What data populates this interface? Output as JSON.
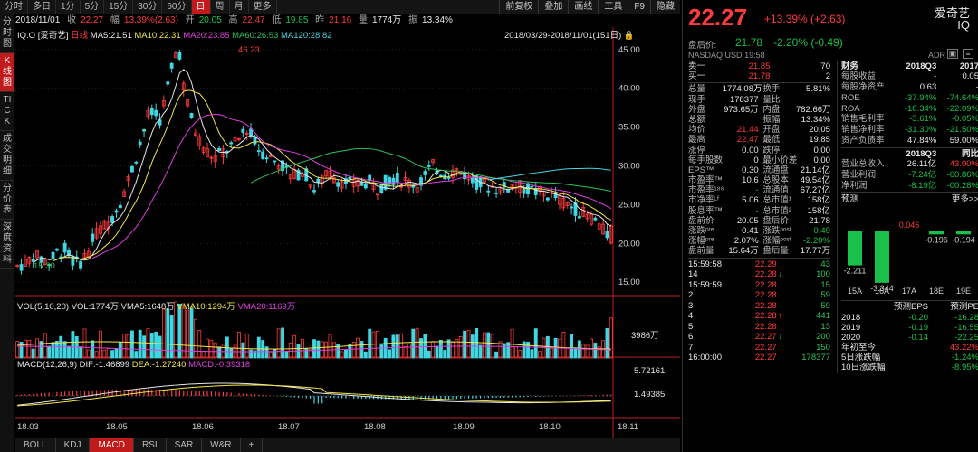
{
  "toolbar": {
    "periods": [
      "分时",
      "多日",
      "1分",
      "5分",
      "15分",
      "30分",
      "60分",
      "日",
      "周",
      "月",
      "更多"
    ],
    "active_period": "日",
    "tools": [
      "前复权",
      "叠加",
      "画线",
      "工具",
      "F9",
      "隐藏"
    ]
  },
  "infoline": {
    "date": "2018/11/01",
    "close_label": "收",
    "close": "22.27",
    "chg_label": "幅",
    "chg": "13.39%(2.63)",
    "open_label": "开",
    "open": "20.05",
    "high_label": "高",
    "high": "22.47",
    "low_label": "低",
    "low": "19.85",
    "prev_label": "昨",
    "prev": "21.16",
    "vol_label": "量",
    "vol": "1774万",
    "amp_label": "振",
    "amp": "13.34%"
  },
  "left_tabs": [
    "分时图",
    "K线图",
    "TICK",
    "成交明细",
    "分价表",
    "深度资料"
  ],
  "active_left_tab": "K线图",
  "main_legend": {
    "symbol": "IQ.O",
    "name": "[爱奇艺]",
    "mode": "日线",
    "ma5": "MA5:21.51",
    "ma10": "MA10:22.31",
    "ma20": "MA20:23.85",
    "ma60": "MA60:26.53",
    "ma120": "MA120:28.82",
    "range": "2018/03/29-2018/11/01(151日)",
    "high_mark": "46.23",
    "low_mark": "15.30"
  },
  "vol_legend": {
    "title": "VOL(5,10,20)",
    "vol": "VOL:1774万",
    "vma5": "VMA5:1648万",
    "vma10": "VMA10:1294万",
    "vma20": "VMA20:1169万",
    "axis_label": "3986万"
  },
  "macd_legend": {
    "title": "MACD(12,26,9)",
    "dif": "DIF:-1.46899",
    "dea": "DEA:-1.27240",
    "macd": "MACD:-0.39318",
    "top": "5.72161",
    "mid": "1.49385"
  },
  "x_labels": [
    "18.03",
    "18.05",
    "18.06",
    "18.07",
    "18.08",
    "18.09",
    "18.10",
    "18.11"
  ],
  "y_labels": [
    "45.00",
    "40.00",
    "35.00",
    "30.00",
    "25.00",
    "20.00",
    "15.00"
  ],
  "bottom_tabs": [
    "BOLL",
    "KDJ",
    "MACD",
    "RSI",
    "SAR",
    "W&R",
    "+"
  ],
  "active_bottom_tab": "MACD",
  "quote": {
    "price": "22.27",
    "change": "+13.39% (+2.63)",
    "name": "爱奇艺",
    "ticker": "IQ",
    "after_label": "盘后价:",
    "after_price": "21.78",
    "after_change": "-2.20% (-0.49)",
    "exchange": "NASDAQ",
    "currency": "USD",
    "time": "19:58",
    "adr": "ADR"
  },
  "orderbook": [
    {
      "label": "卖一",
      "price": "21.85",
      "vol": "70"
    },
    {
      "label": "买一",
      "price": "21.78",
      "vol": "2"
    }
  ],
  "stats": [
    [
      "总量",
      "1774.08万",
      "换手",
      "5.81%"
    ],
    [
      "现手",
      "178377",
      "量比",
      ""
    ],
    [
      "外盘",
      "973.65万",
      "内盘",
      "782.66万"
    ],
    [
      "总额",
      "",
      "振幅",
      "13.34%"
    ],
    [
      "均价",
      "21.44",
      "开盘",
      "20.05"
    ],
    [
      "最高",
      "22.47",
      "最低",
      "19.85"
    ],
    [
      "涨停",
      "0.00",
      "跌停",
      "0.00"
    ],
    [
      "每手股数",
      "0",
      "最小价差",
      "0.00"
    ],
    [
      "EPS™",
      "0.30",
      "流通盘",
      "21.14亿"
    ],
    [
      "市盈率™",
      "10.6",
      "总股本",
      "49.54亿"
    ],
    [
      "市盈率¹⁸⁶",
      "-",
      "流通值",
      "67.27亿"
    ],
    [
      "市净率ᴸᶠ",
      "5.06",
      "总市值¹",
      "158亿"
    ],
    [
      "股息率™",
      "-",
      "总市值²",
      "158亿"
    ],
    [
      "盘前价",
      "20.05",
      "盘后价",
      "21.78"
    ],
    [
      "涨跌ᵖʳᵉ",
      "0.41",
      "涨跌ᵖᵒˢᵗ",
      "-0.49"
    ],
    [
      "涨幅ᵖʳᵉ",
      "2.07%",
      "涨幅ᵖᵒˢᵗ",
      "-2.20%"
    ],
    [
      "盘前量",
      "15.64万",
      "盘后量",
      "17.77万"
    ]
  ],
  "ticks": [
    [
      "15:59:58",
      "22.29",
      "",
      "43"
    ],
    [
      "14",
      "22.28",
      "↓",
      "100"
    ],
    [
      "15:59:59",
      "22.28",
      "",
      "15"
    ],
    [
      "2",
      "22.28",
      "",
      "59"
    ],
    [
      "3",
      "22.28",
      "",
      "59"
    ],
    [
      "4",
      "22.28",
      "↑",
      "441"
    ],
    [
      "5",
      "22.28",
      "",
      "13"
    ],
    [
      "6",
      "22.27",
      "↓",
      "200"
    ],
    [
      "7",
      "22.27",
      "",
      "150"
    ],
    [
      "16:00:00",
      "22.27",
      "",
      "178377"
    ]
  ],
  "finance": {
    "header": [
      "财务",
      "2018Q3",
      "2017"
    ],
    "rows": [
      [
        "每股收益",
        "-",
        "0.05"
      ],
      [
        "每股净资产",
        "0.63",
        "-"
      ],
      [
        "ROE",
        "-37.94%",
        "-74.64%"
      ],
      [
        "ROA",
        "-18.34%",
        "-22.09%"
      ],
      [
        "销售毛利率",
        "-3.61%",
        "-0.05%"
      ],
      [
        "销售净利率",
        "-31.30%",
        "-21.50%"
      ],
      [
        "资产负债率",
        "47.84%",
        "59.00%"
      ]
    ],
    "q_header": [
      "",
      "2018Q3",
      "同比"
    ],
    "q_rows": [
      [
        "营业总收入",
        "26.11亿",
        "43.00%"
      ],
      [
        "营业利润",
        "-7.24亿",
        "-60.86%"
      ],
      [
        "净利润",
        "-8.19亿",
        "-00.28%"
      ]
    ]
  },
  "forecast": {
    "title": "预测",
    "more": "更多>>",
    "bars": [
      {
        "label": "15A",
        "value": -2.211
      },
      {
        "label": "16A",
        "value": -3.344
      },
      {
        "label": "17A",
        "value": 0.046
      },
      {
        "label": "18E",
        "value": -0.196
      },
      {
        "label": "19E",
        "value": -0.194
      }
    ],
    "bar_texts": [
      "-2.211",
      "-3.344",
      "0.046",
      "-0.196",
      "-0.194"
    ],
    "table_header": [
      "",
      "预测EPS",
      "预测PE"
    ],
    "table_rows": [
      [
        "2018",
        "-0.20",
        "-16.28"
      ],
      [
        "2019",
        "-0.19",
        "-16.55"
      ],
      [
        "2020",
        "-0.14",
        "-22.25"
      ]
    ],
    "extra_rows": [
      [
        "年初至今",
        "",
        "43.22%"
      ],
      [
        "5日涨跌幅",
        "",
        "-1.24%"
      ],
      [
        "10日涨跌幅",
        "",
        "-8.95%"
      ]
    ]
  },
  "colors": {
    "up": "#ff3b3b",
    "down": "#19c14a",
    "ma5": "#e6e6e6",
    "ma10": "#f2e74b",
    "ma20": "#e040e0",
    "ma60": "#2fc25b",
    "ma120": "#47d6e6",
    "accent": "#c21a1a"
  }
}
